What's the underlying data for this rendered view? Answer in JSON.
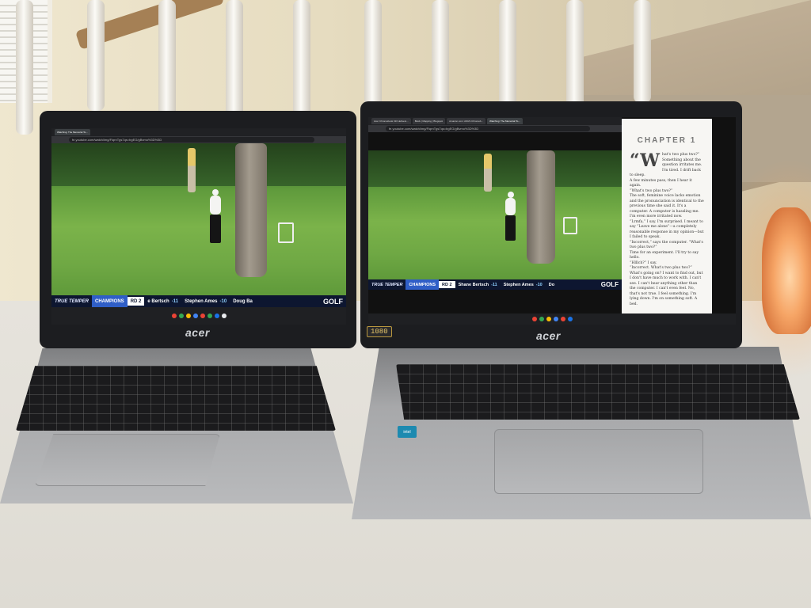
{
  "left_laptop": {
    "brand": "acer",
    "tabs": [
      {
        "label": "Watching: The Memorial To...",
        "active": true
      }
    ],
    "address": "fe.youtube.com/watch/img/FiqrnTgs7qs=bgEG/gBvmo%3D%3D",
    "ticker": {
      "brand": "TRUE TEMPER",
      "champions": "CHAMPIONS",
      "round": "RD 2",
      "entries": [
        {
          "name": "Bertsch",
          "prefix": "e ",
          "score": "-11"
        },
        {
          "name": "Stephen Ames",
          "score": "-10"
        },
        {
          "name": "Doug Ba",
          "score": ""
        }
      ],
      "network": "GOLF"
    }
  },
  "right_laptop": {
    "brand": "acer",
    "tabs": [
      {
        "label": "Acer Chromebook 316 delivers...",
        "active": false
      },
      {
        "label": "Block | Mapping | Blogspot",
        "active": false
      },
      {
        "label": "Amazon.com: ASUS Chromeb...",
        "active": false
      },
      {
        "label": "Watching: The Memorial To...",
        "active": true
      }
    ],
    "address": "fe.youtube.com/watch/img/FiqrnTgs7qs=bgEG/gBvmo%3D%3D",
    "ticker": {
      "brand": "TRUE TEMPER",
      "champions": "CHAMPIONS",
      "round": "RD 2",
      "entries": [
        {
          "name": "Shane Bertsch",
          "score": "-11"
        },
        {
          "name": "Stephen Ames",
          "score": "-10"
        },
        {
          "name": "Do",
          "score": ""
        }
      ],
      "network": "GOLF"
    },
    "reader": {
      "chapter": "CHAPTER 1",
      "dropcap": "“W",
      "paragraphs": [
        "hat's two plus two?” Something about the question irritates me. I'm tired. I drift back to sleep.",
        "A few minutes pass, then I hear it again.",
        "“What's two plus two?”",
        "The soft, feminine voice lacks emotion and the pronunciation is identical to the previous time she said it. It's a computer. A computer is hassling me. I'm even more irritated now.",
        "“Lrmfa,” I say. I'm surprised. I meant to say “Leave me alone”—a completely reasonable response in my opinion—but I failed to speak.",
        "“Incorrect,” says the computer. “What's two plus two?”",
        "Time for an experiment. I'll try to say hello.",
        "“Hlllch?” I say.",
        "“Incorrect. What's two plus two?”",
        "What's going on? I want to find out, but I don't have much to work with. I can't see. I can't hear anything other than the computer. I can't even feel. No, that's not true. I feel something. I'm lying down. I'm on something soft. A bed."
      ]
    },
    "hd_badge": "1080",
    "sticker": "intel"
  },
  "colors": {
    "ticker_bg": "#0d1630",
    "champions_bg": "#2f5ec7",
    "score": "#8fd0ff",
    "grass": "#7bb34a",
    "reader_bg": "#f7f6f3"
  }
}
